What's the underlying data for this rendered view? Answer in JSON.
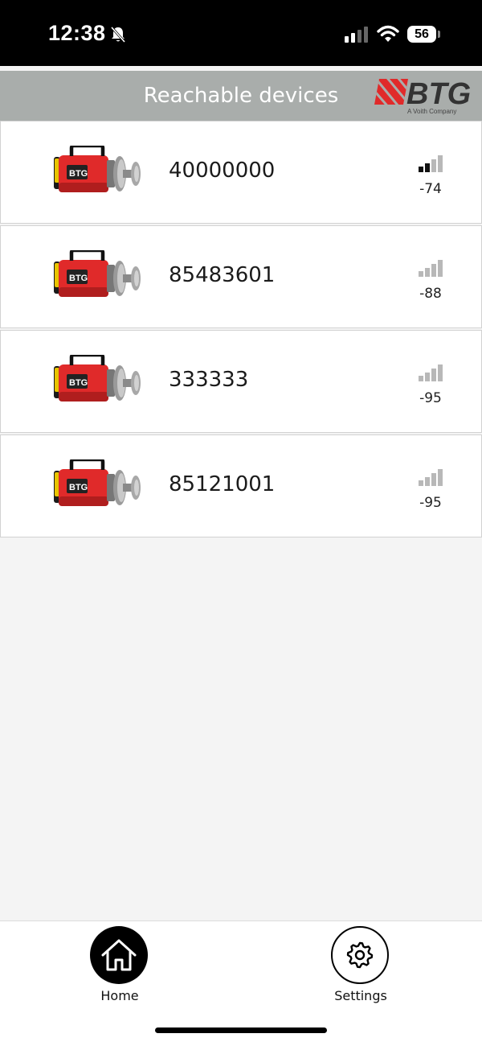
{
  "status_bar": {
    "time": "12:38",
    "battery": "56",
    "icons": [
      "bell-off-icon",
      "cellular-signal-icon",
      "wifi-icon",
      "battery-icon"
    ]
  },
  "header": {
    "title": "Reachable devices",
    "logo_text": "BTG",
    "logo_tagline": "A Voith Company",
    "background_color": "#a9adab"
  },
  "devices": [
    {
      "id": "40000000",
      "rssi": "-74",
      "signal_bars": 2
    },
    {
      "id": "85483601",
      "rssi": "-88",
      "signal_bars": 0
    },
    {
      "id": "333333",
      "rssi": "-95",
      "signal_bars": 0
    },
    {
      "id": "85121001",
      "rssi": "-95",
      "signal_bars": 0
    }
  ],
  "tabs": [
    {
      "label": "Home",
      "icon": "home-icon",
      "active": true
    },
    {
      "label": "Settings",
      "icon": "gear-icon",
      "active": false
    }
  ],
  "colors": {
    "brand_red": "#e02a2a",
    "signal_active": "#111111",
    "signal_inactive": "#b8b8b8"
  }
}
